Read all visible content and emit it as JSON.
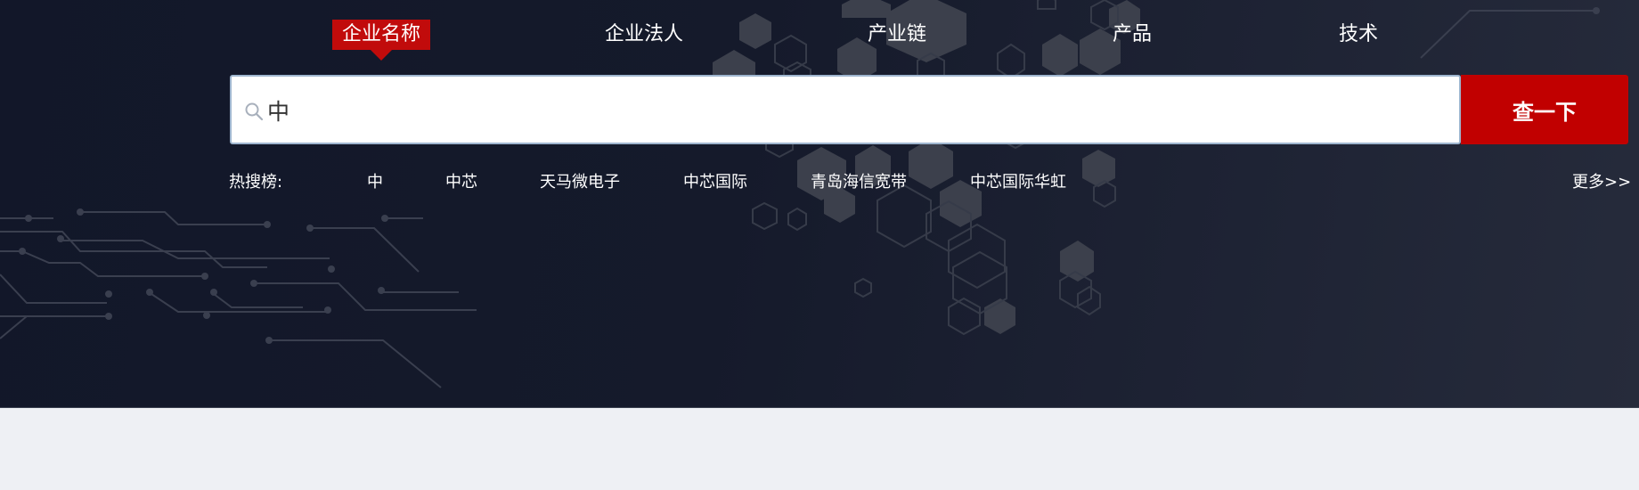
{
  "tabs": [
    {
      "label": "企业名称",
      "active": true
    },
    {
      "label": "企业法人",
      "active": false
    },
    {
      "label": "产业链",
      "active": false
    },
    {
      "label": "产品",
      "active": false
    },
    {
      "label": "技术",
      "active": false
    }
  ],
  "search": {
    "value": "中",
    "button_label": "查一下",
    "icon": "search-icon"
  },
  "hot": {
    "label": "热搜榜:",
    "items": [
      "中",
      "中芯",
      "天马微电子",
      "中芯国际",
      "青岛海信宽带",
      "中芯国际华虹"
    ],
    "more_label": "更多>>"
  },
  "colors": {
    "accent": "#c10b0b",
    "hero_bg": "#151a2b",
    "page_bg": "#eef0f4"
  }
}
